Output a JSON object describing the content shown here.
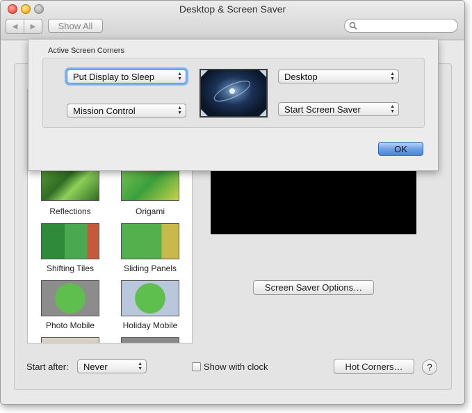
{
  "window": {
    "title": "Desktop & Screen Saver",
    "show_all_label": "Show All",
    "search_placeholder": ""
  },
  "sheet": {
    "heading": "Active Screen Corners",
    "top_left": "Put Display to Sleep",
    "bottom_left": "Mission Control",
    "top_right": "Desktop",
    "bottom_right": "Start Screen Saver",
    "ok_label": "OK"
  },
  "savers": [
    {
      "label": "Reflections"
    },
    {
      "label": "Origami"
    },
    {
      "label": "Shifting Tiles"
    },
    {
      "label": "Sliding Panels"
    },
    {
      "label": "Photo Mobile"
    },
    {
      "label": "Holiday Mobile"
    }
  ],
  "preview": {
    "options_label": "Screen Saver Options…"
  },
  "bottom_bar": {
    "start_after_label": "Start after:",
    "start_after_value": "Never",
    "show_clock_label": "Show with clock",
    "show_clock_checked": false,
    "hot_corners_label": "Hot Corners…",
    "help_label": "?"
  },
  "colors": {
    "ok_button": "#5b90dc",
    "focus_ring": "#7fb3ee"
  }
}
